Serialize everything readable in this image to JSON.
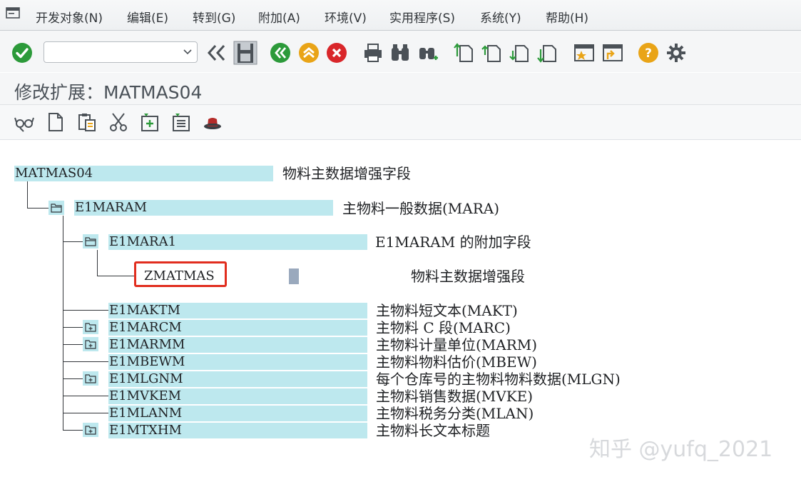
{
  "menu": {
    "items": [
      {
        "label": "开发对象(N)",
        "name": "menu-development-object"
      },
      {
        "label": "编辑(E)",
        "name": "menu-edit"
      },
      {
        "label": "转到(G)",
        "name": "menu-goto"
      },
      {
        "label": "附加(A)",
        "name": "menu-extras"
      },
      {
        "label": "环境(V)",
        "name": "menu-environment"
      },
      {
        "label": "实用程序(S)",
        "name": "menu-utilities"
      },
      {
        "label": "系统(Y)",
        "name": "menu-system"
      },
      {
        "label": "帮助(H)",
        "name": "menu-help"
      }
    ]
  },
  "toolbar": {
    "command_value": "",
    "icons": [
      "enter-check-icon",
      "back-double-chevron-icon",
      "save-icon",
      "back-icon",
      "exit-up-icon",
      "cancel-icon",
      "print-icon",
      "find-icon",
      "find-next-icon",
      "first-page-icon",
      "previous-page-icon",
      "next-page-icon",
      "last-page-icon",
      "create-session-icon",
      "shortcut-icon",
      "help-icon",
      "settings-gear-icon"
    ],
    "colors": {
      "green": "#2c9a3a",
      "orange": "#e9a417",
      "red": "#d9262a",
      "dark": "#4b5157"
    }
  },
  "title": "修改扩展：MATMAS04",
  "app_toolbar": {
    "icons": [
      "display-glasses-icon",
      "new-document-icon",
      "copy-paste-icon",
      "cut-scissors-icon",
      "insert-child-segment-icon",
      "insert-sibling-segment-icon",
      "hat-icon"
    ]
  },
  "tree": {
    "root": {
      "name": "MATMAS04",
      "description": "物料主数据增强字段"
    },
    "level1": {
      "name": "E1MARAM",
      "description": "主物料一般数据(MARA)"
    },
    "level2": {
      "name": "E1MARA1",
      "description": "E1MARAM 的附加字段"
    },
    "extension": {
      "name": "ZMATMAS",
      "description": "物料主数据增强段"
    },
    "children": [
      {
        "name": "E1MAKTM",
        "description": "主物料短文本(MAKT)",
        "folder": false
      },
      {
        "name": "E1MARCM",
        "description": "主物料 C 段(MARC)",
        "folder": true
      },
      {
        "name": "E1MARMM",
        "description": "主物料计量单位(MARM)",
        "folder": true
      },
      {
        "name": "E1MBEWM",
        "description": "主物料物料估价(MBEW)",
        "folder": false
      },
      {
        "name": "E1MLGNM",
        "description": "每个仓库号的主物料物料数据(MLGN)",
        "folder": true
      },
      {
        "name": "E1MVKEM",
        "description": "主物料销售数据(MVKE)",
        "folder": false
      },
      {
        "name": "E1MLANM",
        "description": "主物料税务分类(MLAN)",
        "folder": false
      },
      {
        "name": "E1MTXHM",
        "description": "主物料长文本标题",
        "folder": true
      }
    ],
    "highlight_color": "#bde8ee",
    "marker_color": "#e12d1e"
  },
  "watermark": "知乎 @yufq_2021"
}
